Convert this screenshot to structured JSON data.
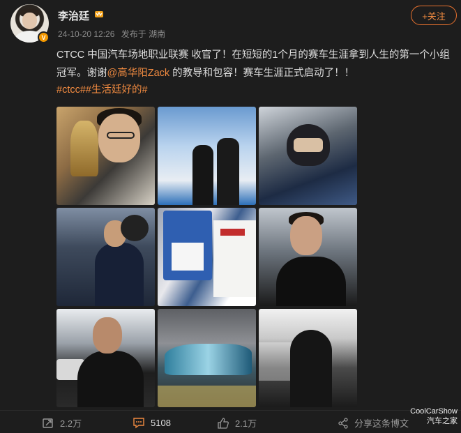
{
  "author": {
    "name": "李治廷",
    "verified_badge": "V",
    "timestamp": "24-10-20 12:26",
    "source": "发布于 湖南"
  },
  "follow_button": {
    "label": "+关注"
  },
  "post": {
    "text_part1": "CTCC 中国汽车场地职业联赛 收官了！在短短的1个月的赛车生涯拿到人生的第一个小组冠军。谢谢",
    "mention": "@高华阳Zack",
    "text_part2": " 的教导和包容！赛车生涯正式启动了！！",
    "hashtags": "#ctcc##生活廷好的#"
  },
  "photos": [
    "trophy-photo",
    "podium-photo",
    "helmet-photo",
    "driver-suit-photo",
    "license-photo",
    "earpiece-photo",
    "back-view-photo",
    "race-car-photo",
    "silhouette-photo"
  ],
  "footer": {
    "repost_count": "2.2万",
    "comment_count": "5108",
    "like_count": "2.1万",
    "share_label": "分享这条博文"
  },
  "watermark": {
    "line1": "CoolCarShow",
    "line2": "汽车之家"
  },
  "colors": {
    "accent": "#f08a40",
    "background": "#1d1d1d",
    "badge": "#f39800"
  }
}
